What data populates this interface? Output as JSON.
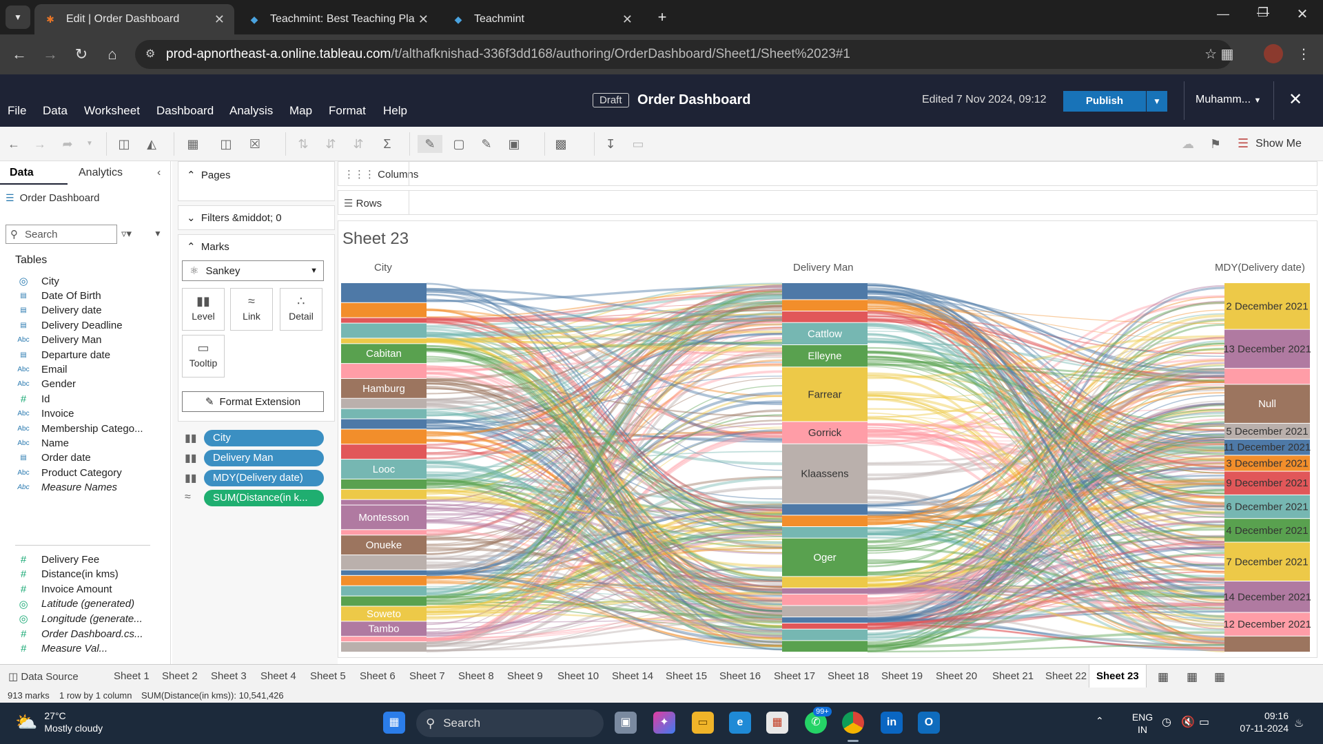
{
  "browser": {
    "tabs": [
      {
        "title": "Edit | Order Dashboard",
        "active": true
      },
      {
        "title": "Teachmint: Best Teaching Platfo",
        "active": false
      },
      {
        "title": "Teachmint",
        "active": false
      }
    ],
    "url_host": "prod-apnortheast-a.online.tableau.com",
    "url_path": "/t/althafknishad-336f3dd168/authoring/OrderDashboard/Sheet1/Sheet%2023#1"
  },
  "header": {
    "menu": [
      "File",
      "Data",
      "Worksheet",
      "Dashboard",
      "Analysis",
      "Map",
      "Format",
      "Help"
    ],
    "draft_label": "Draft",
    "workbook_title": "Order Dashboard",
    "edited": "Edited 7 Nov 2024, 09:12",
    "publish_label": "Publish",
    "user": "Muhamm..."
  },
  "toolbar": {
    "show_me": "Show Me"
  },
  "datapane": {
    "tab_data": "Data",
    "tab_analytics": "Analytics",
    "datasource": "Order Dashboard",
    "search_placeholder": "Search",
    "tables_title": "Tables",
    "fields": [
      {
        "name": "City",
        "type": "geo",
        "italic": false
      },
      {
        "name": "Date Of Birth",
        "type": "date",
        "italic": false
      },
      {
        "name": "Delivery date",
        "type": "date",
        "italic": false
      },
      {
        "name": "Delivery Deadline",
        "type": "date",
        "italic": false
      },
      {
        "name": "Delivery Man",
        "type": "abc",
        "italic": false
      },
      {
        "name": "Departure date",
        "type": "date",
        "italic": false
      },
      {
        "name": "Email",
        "type": "abc",
        "italic": false
      },
      {
        "name": "Gender",
        "type": "abc",
        "italic": false
      },
      {
        "name": "Id",
        "type": "num",
        "italic": false
      },
      {
        "name": "Invoice",
        "type": "abc",
        "italic": false
      },
      {
        "name": "Membership Catego...",
        "type": "abc",
        "italic": false
      },
      {
        "name": "Name",
        "type": "abc",
        "italic": false
      },
      {
        "name": "Order date",
        "type": "date",
        "italic": false
      },
      {
        "name": "Product Category",
        "type": "abc",
        "italic": false
      },
      {
        "name": "Measure Names",
        "type": "abc",
        "italic": true
      }
    ],
    "measures": [
      {
        "name": "Delivery Fee",
        "type": "num",
        "italic": false
      },
      {
        "name": "Distance(in kms)",
        "type": "num",
        "italic": false
      },
      {
        "name": "Invoice Amount",
        "type": "num",
        "italic": false
      },
      {
        "name": "Latitude (generated)",
        "type": "geo",
        "italic": true
      },
      {
        "name": "Longitude (generate...",
        "type": "geo",
        "italic": true
      },
      {
        "name": "Order Dashboard.cs...",
        "type": "num",
        "italic": true
      },
      {
        "name": "Measure Val...",
        "type": "num",
        "italic": true
      }
    ]
  },
  "shelves": {
    "pages": "Pages",
    "filters": "Filters &middot; 0",
    "marks": "Marks",
    "mark_type": "Sankey",
    "mark_buttons": [
      "Level",
      "Link",
      "Detail",
      "Tooltip"
    ],
    "format_extension": "Format Extension",
    "pills": [
      {
        "label": "City",
        "color": "blue"
      },
      {
        "label": "Delivery Man",
        "color": "blue"
      },
      {
        "label": "MDY(Delivery date)",
        "color": "blue"
      },
      {
        "label": "SUM(Distance(in k...",
        "color": "green"
      }
    ],
    "columns": "Columns",
    "rows": "Rows"
  },
  "view": {
    "sheet_title": "Sheet 23",
    "col1_label": "City",
    "col2_label": "Delivery Man",
    "col3_label": "MDY(Delivery date)",
    "city_nodes": [
      {
        "label": "",
        "color": "#4e79a7",
        "size": 4
      },
      {
        "label": "",
        "color": "#f28e2b",
        "size": 3
      },
      {
        "label": "",
        "color": "#e15759",
        "size": 1
      },
      {
        "label": "",
        "color": "#76b7b2",
        "size": 3
      },
      {
        "label": "",
        "color": "#edc948",
        "size": 1
      },
      {
        "label": "Cabitan",
        "color": "#59a14f",
        "size": 4
      },
      {
        "label": "",
        "color": "#ff9da7",
        "size": 3
      },
      {
        "label": "Hamburg",
        "color": "#9c755f",
        "size": 4
      },
      {
        "label": "",
        "color": "#bab0ac",
        "size": 2
      },
      {
        "label": "",
        "color": "#76b7b2",
        "size": 2
      },
      {
        "label": "",
        "color": "#4e79a7",
        "size": 2
      },
      {
        "label": "",
        "color": "#f28e2b",
        "size": 3
      },
      {
        "label": "",
        "color": "#e15759",
        "size": 3
      },
      {
        "label": "Looc",
        "color": "#76b7b2",
        "size": 4
      },
      {
        "label": "",
        "color": "#59a14f",
        "size": 2
      },
      {
        "label": "",
        "color": "#edc948",
        "size": 2
      },
      {
        "label": "",
        "color": "#b07aa1",
        "size": 1
      },
      {
        "label": "Montesson",
        "color": "#b07aa1",
        "size": 5
      },
      {
        "label": "",
        "color": "#ff9da7",
        "size": 1
      },
      {
        "label": "Onueke",
        "color": "#9c755f",
        "size": 4
      },
      {
        "label": "",
        "color": "#bab0ac",
        "size": 3
      },
      {
        "label": "",
        "color": "#4e79a7",
        "size": 1
      },
      {
        "label": "",
        "color": "#f28e2b",
        "size": 2
      },
      {
        "label": "",
        "color": "#76b7b2",
        "size": 2
      },
      {
        "label": "",
        "color": "#59a14f",
        "size": 2
      },
      {
        "label": "Soweto",
        "color": "#edc948",
        "size": 3
      },
      {
        "label": "Tambo",
        "color": "#b07aa1",
        "size": 3
      },
      {
        "label": "",
        "color": "#ff9da7",
        "size": 1
      },
      {
        "label": "",
        "color": "#bab0ac",
        "size": 2
      }
    ],
    "man_nodes": [
      {
        "label": "",
        "color": "#4e79a7",
        "size": 3
      },
      {
        "label": "",
        "color": "#f28e2b",
        "size": 2
      },
      {
        "label": "",
        "color": "#e15759",
        "size": 2
      },
      {
        "label": "Cattlow",
        "color": "#76b7b2",
        "size": 4
      },
      {
        "label": "Elleyne",
        "color": "#59a14f",
        "size": 4
      },
      {
        "label": "Farrear",
        "color": "#edc948",
        "size": 10
      },
      {
        "label": "Gorrick",
        "color": "#ff9da7",
        "size": 4
      },
      {
        "label": "Klaassens",
        "color": "#bab0ac",
        "size": 11
      },
      {
        "label": "",
        "color": "#4e79a7",
        "size": 2
      },
      {
        "label": "",
        "color": "#f28e2b",
        "size": 2
      },
      {
        "label": "",
        "color": "#76b7b2",
        "size": 2
      },
      {
        "label": "Oger",
        "color": "#59a14f",
        "size": 7
      },
      {
        "label": "",
        "color": "#edc948",
        "size": 2
      },
      {
        "label": "",
        "color": "#b07aa1",
        "size": 1
      },
      {
        "label": "",
        "color": "#ff9da7",
        "size": 2
      },
      {
        "label": "",
        "color": "#bab0ac",
        "size": 2
      },
      {
        "label": "",
        "color": "#4e79a7",
        "size": 1
      },
      {
        "label": "",
        "color": "#e15759",
        "size": 1
      },
      {
        "label": "",
        "color": "#76b7b2",
        "size": 2
      },
      {
        "label": "",
        "color": "#59a14f",
        "size": 2
      }
    ],
    "date_nodes": [
      {
        "label": "2 December 2021",
        "color": "#edc948",
        "size": 6
      },
      {
        "label": "13 December 2021",
        "color": "#b07aa1",
        "size": 5
      },
      {
        "label": "",
        "color": "#ff9da7",
        "size": 2
      },
      {
        "label": "Null",
        "color": "#9c755f",
        "size": 5
      },
      {
        "label": "5 December 2021",
        "color": "#bab0ac",
        "size": 2
      },
      {
        "label": "11 December 2021",
        "color": "#4e79a7",
        "size": 2
      },
      {
        "label": "3 December 2021",
        "color": "#f28e2b",
        "size": 2
      },
      {
        "label": "9 December 2021",
        "color": "#e15759",
        "size": 3
      },
      {
        "label": "6 December 2021",
        "color": "#76b7b2",
        "size": 3
      },
      {
        "label": "4 December 2021",
        "color": "#59a14f",
        "size": 3
      },
      {
        "label": "7 December 2021",
        "color": "#edc948",
        "size": 5
      },
      {
        "label": "14 December 2021",
        "color": "#b07aa1",
        "size": 4
      },
      {
        "label": "12 December 2021",
        "color": "#ff9da7",
        "size": 3
      },
      {
        "label": "",
        "color": "#9c755f",
        "size": 2
      }
    ]
  },
  "sheet_tabs": {
    "data_source": "Data Source",
    "tabs": [
      "Sheet 1",
      "Sheet 2",
      "Sheet 3",
      "Sheet 4",
      "Sheet 5",
      "Sheet 6",
      "Sheet 7",
      "Sheet 8",
      "Sheet 9",
      "Sheet 10",
      "Sheet 14",
      "Sheet 15",
      "Sheet 16",
      "Sheet 17",
      "Sheet 18",
      "Sheet 19",
      "Sheet 20",
      "Sheet 21",
      "Sheet 22",
      "Sheet 23"
    ],
    "active": "Sheet 23"
  },
  "status": {
    "marks": "913 marks",
    "dims": "1 row by 1 column",
    "sum": "SUM(Distance(in kms)): 10,541,426"
  },
  "taskbar": {
    "temp": "27°C",
    "weather": "Mostly cloudy",
    "search": "Search",
    "badge": "99+",
    "lang1": "ENG",
    "lang2": "IN",
    "time": "09:16",
    "date": "07-11-2024"
  }
}
